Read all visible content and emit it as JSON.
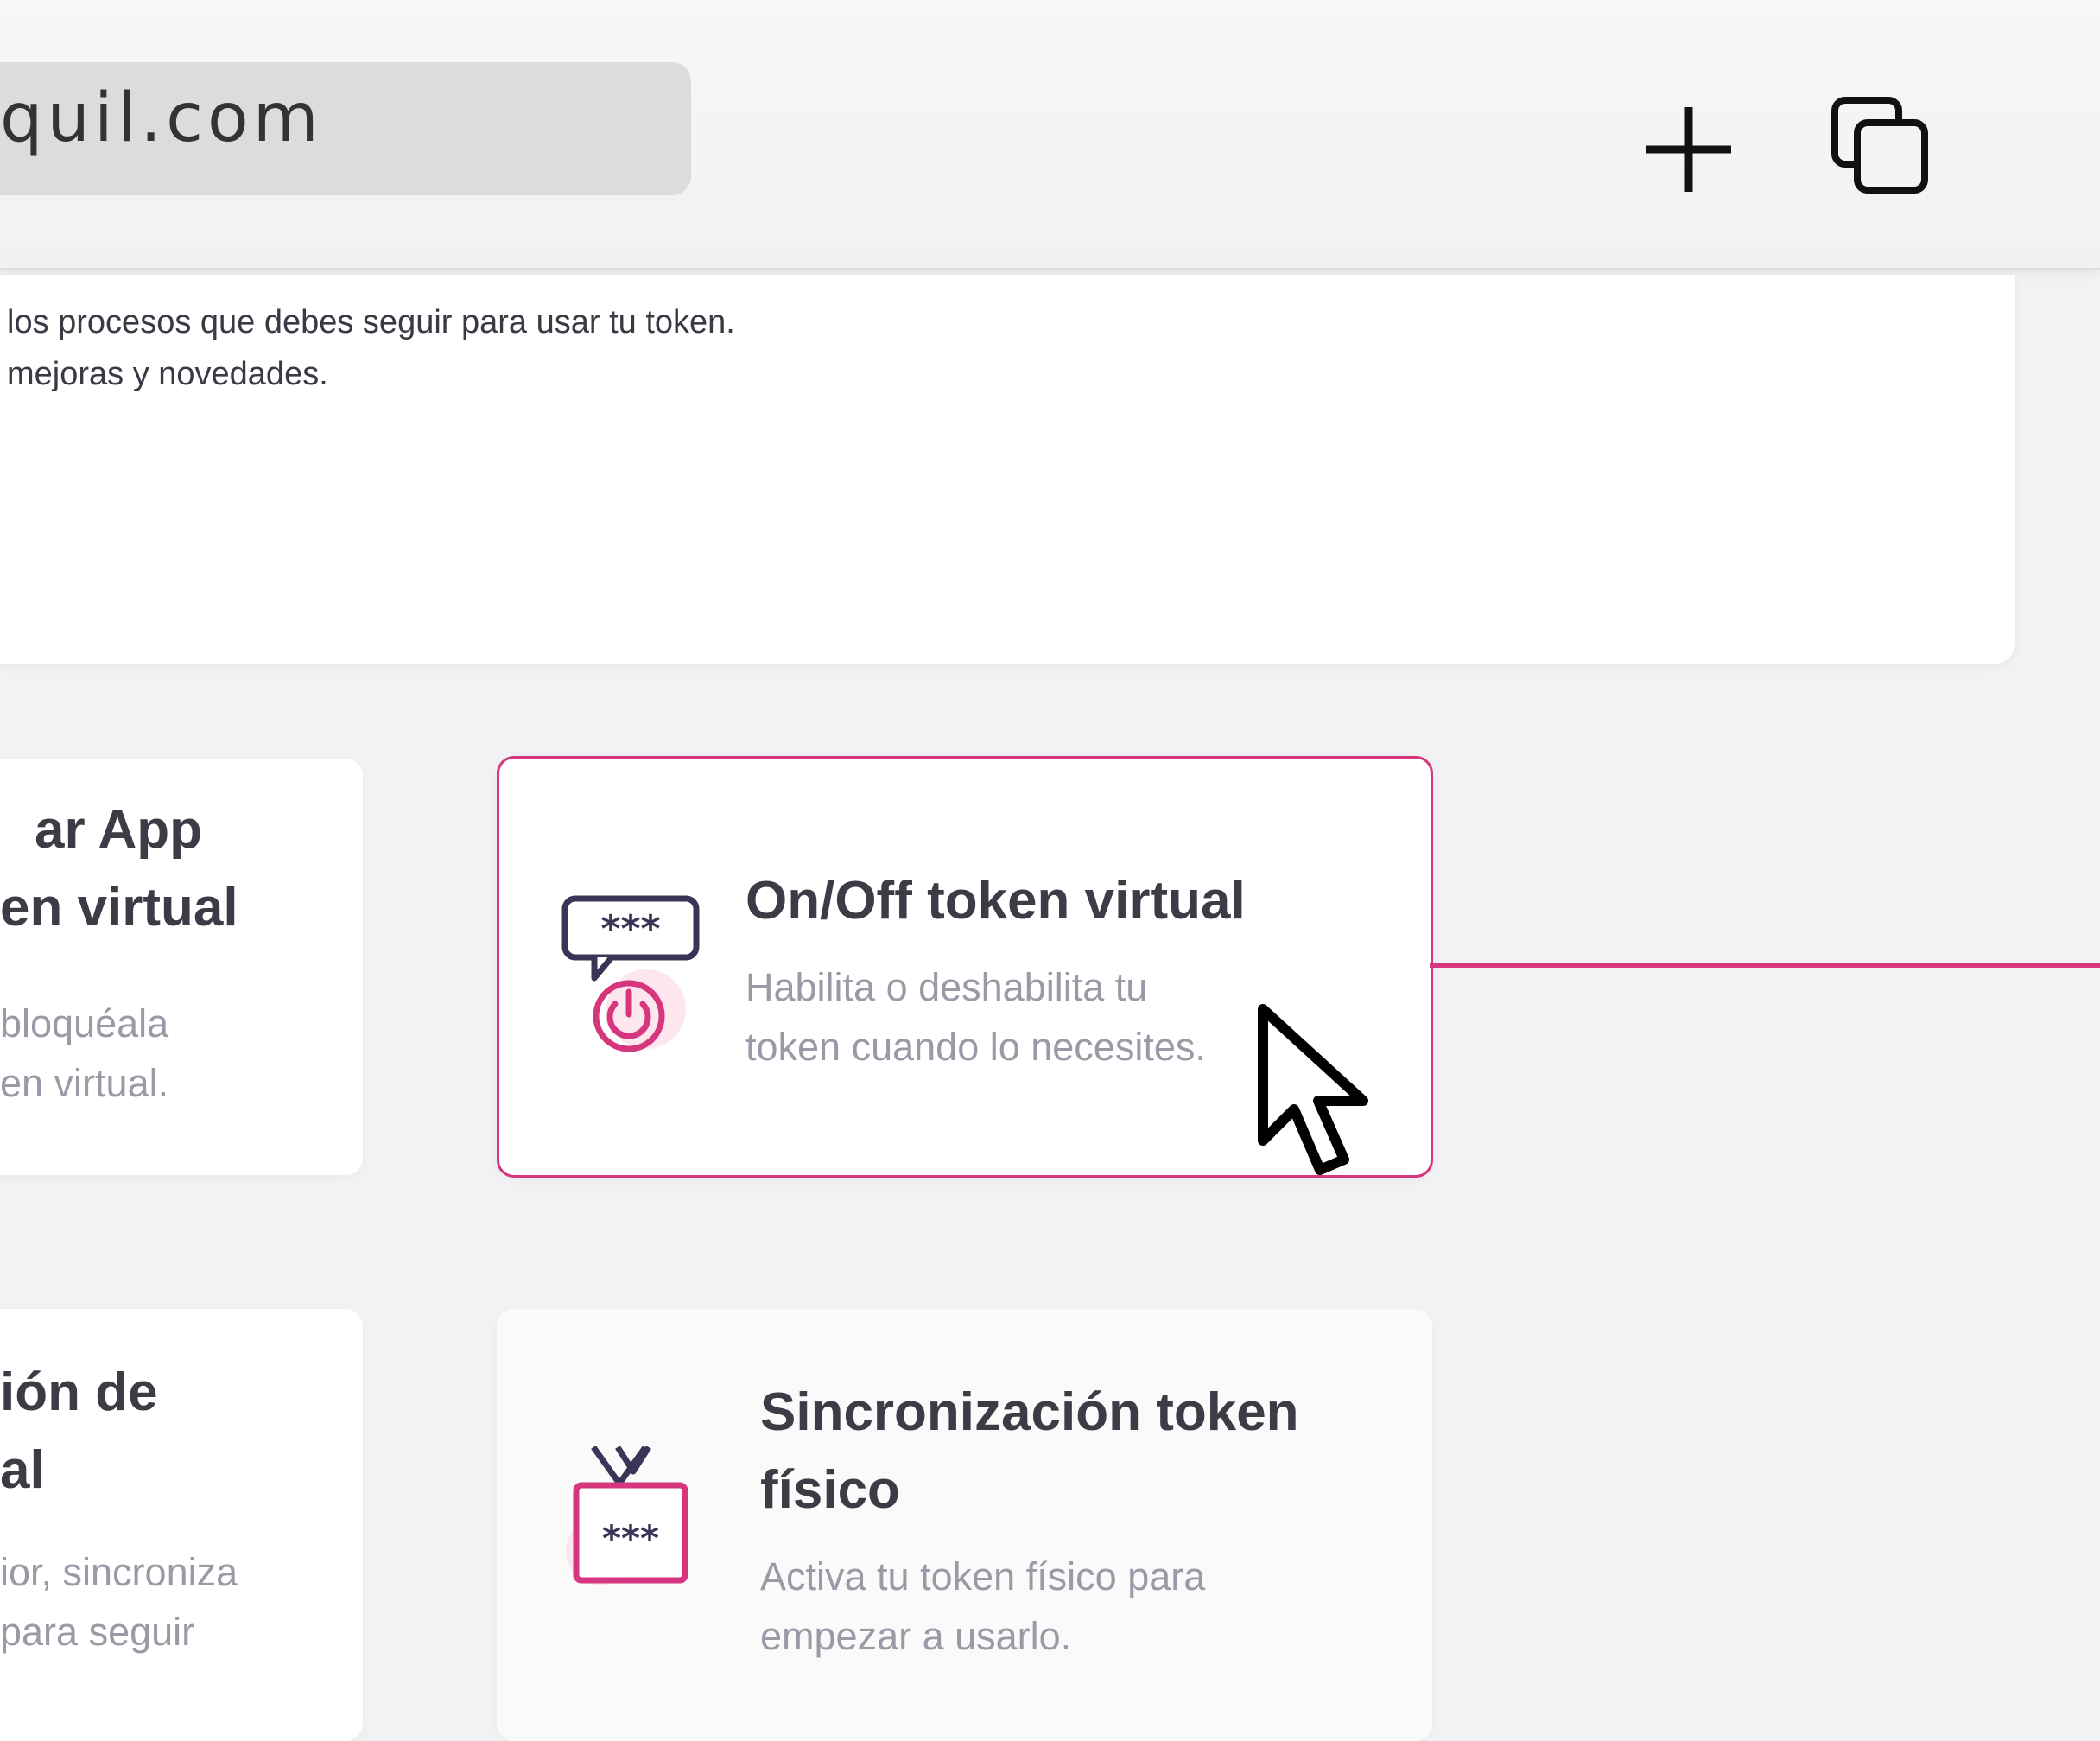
{
  "browser": {
    "url_fragment": "quil.com",
    "new_tab_label": "+",
    "tabs_label": "tabs"
  },
  "info": {
    "line1": "los procesos que debes seguir para usar tu token.",
    "line2": "mejoras y novedades."
  },
  "cards": [
    {
      "title_line1": "ar App",
      "title_line2": "en virtual",
      "desc_line1": "bloquéala",
      "desc_line2": "en virtual."
    },
    {
      "title_line1": "On/Off token virtual",
      "desc_line1": "Habilita o deshabilita tu",
      "desc_line2": "token cuando lo necesites.",
      "icon": "token-power-icon",
      "icon_text": "***"
    },
    {
      "title_line1": "ión de",
      "title_line2": "al",
      "desc_line1": "ior, sincroniza",
      "desc_line2": "para seguir"
    },
    {
      "title_line1": "Sincronización token",
      "title_line2": "físico",
      "desc_line1": "Activa tu token físico para",
      "desc_line2": "empezar a usarlo.",
      "icon": "physical-token-icon",
      "icon_text": "***"
    }
  ],
  "colors": {
    "accent": "#d6367e",
    "icon_dark": "#3a3556",
    "title": "#3c3c46",
    "desc": "#9a9aa6"
  }
}
